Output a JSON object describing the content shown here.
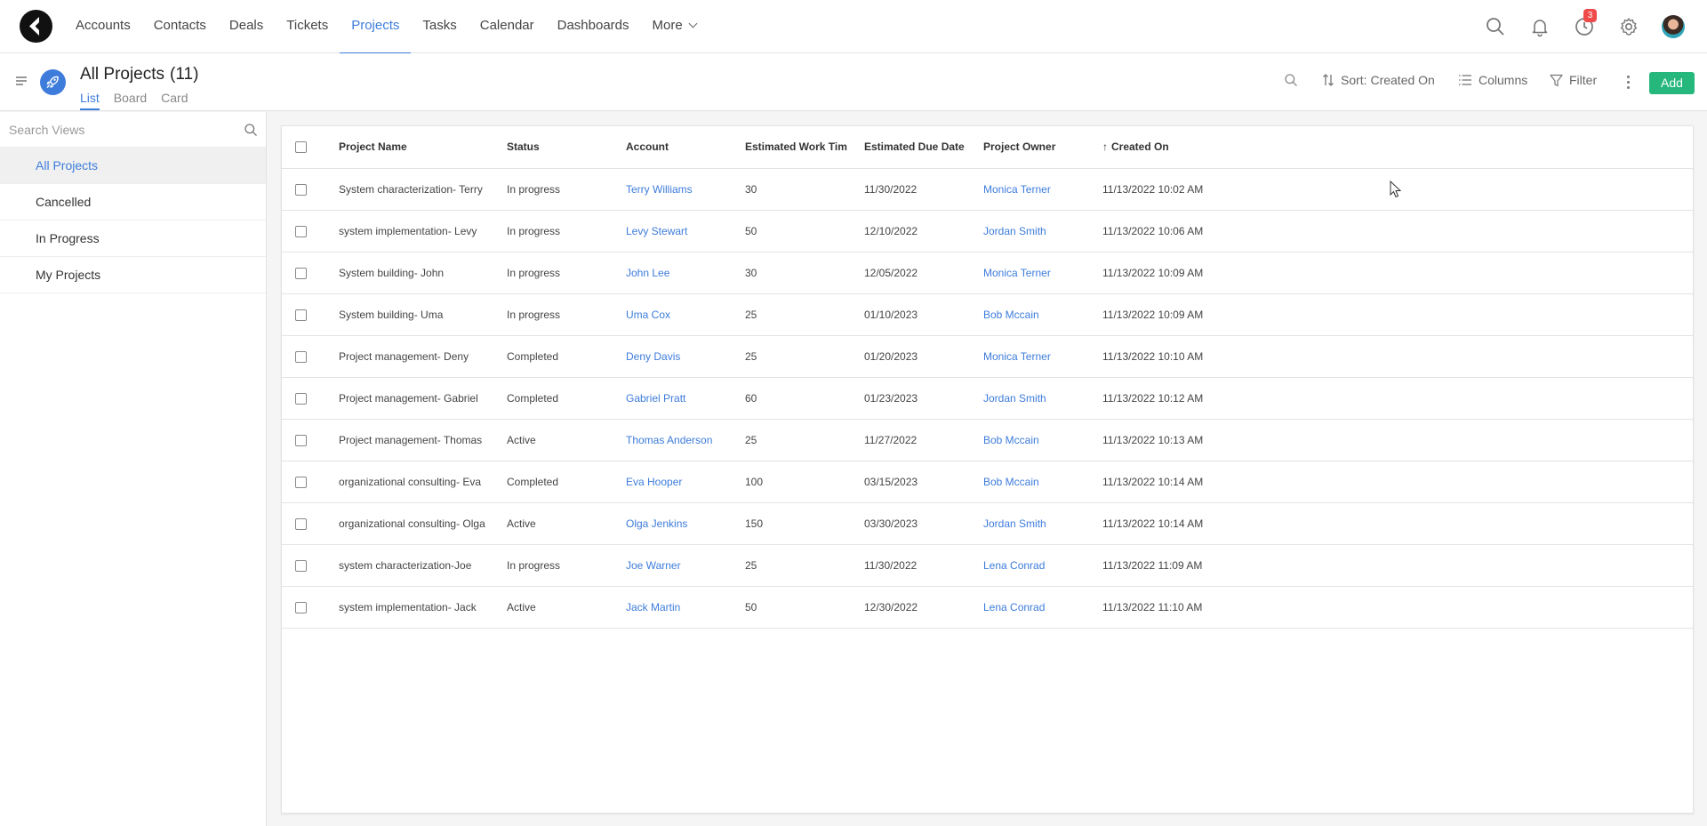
{
  "nav": {
    "items": [
      {
        "label": "Accounts",
        "active": false
      },
      {
        "label": "Contacts",
        "active": false
      },
      {
        "label": "Deals",
        "active": false
      },
      {
        "label": "Tickets",
        "active": false
      },
      {
        "label": "Projects",
        "active": true
      },
      {
        "label": "Tasks",
        "active": false
      },
      {
        "label": "Calendar",
        "active": false
      },
      {
        "label": "Dashboards",
        "active": false
      }
    ],
    "more_label": "More",
    "reminder_badge": "3",
    "accent": "#3d7cdb"
  },
  "header": {
    "title": "All Projects",
    "count": "(11)",
    "tabs": [
      {
        "label": "List",
        "active": true
      },
      {
        "label": "Board",
        "active": false
      },
      {
        "label": "Card",
        "active": false
      }
    ],
    "sort_label": "Sort: Created On",
    "columns_label": "Columns",
    "filter_label": "Filter",
    "add_label": "Add",
    "add_color": "#26b77d"
  },
  "sidebar": {
    "search_placeholder": "Search Views",
    "views": [
      {
        "label": "All Projects",
        "active": true
      },
      {
        "label": "Cancelled",
        "active": false
      },
      {
        "label": "In Progress",
        "active": false
      },
      {
        "label": "My Projects",
        "active": false
      }
    ]
  },
  "table": {
    "columns": [
      "Project Name",
      "Status",
      "Account",
      "Estimated Work Tim",
      "Estimated Due Date",
      "Project Owner",
      "Created On"
    ],
    "rows": [
      {
        "name": "System characterization- Terry",
        "status": "In progress",
        "account": "Terry Williams",
        "work": "30",
        "due": "11/30/2022",
        "owner": "Monica Terner",
        "created": "11/13/2022 10:02 AM"
      },
      {
        "name": "system implementation- Levy",
        "status": "In progress",
        "account": "Levy Stewart",
        "work": "50",
        "due": "12/10/2022",
        "owner": "Jordan Smith",
        "created": "11/13/2022 10:06 AM"
      },
      {
        "name": "System building- John",
        "status": "In progress",
        "account": "John Lee",
        "work": "30",
        "due": "12/05/2022",
        "owner": "Monica Terner",
        "created": "11/13/2022 10:09 AM"
      },
      {
        "name": "System building- Uma",
        "status": "In progress",
        "account": "Uma Cox",
        "work": "25",
        "due": "01/10/2023",
        "owner": "Bob Mccain",
        "created": "11/13/2022 10:09 AM"
      },
      {
        "name": "Project management- Deny",
        "status": "Completed",
        "account": "Deny Davis",
        "work": "25",
        "due": "01/20/2023",
        "owner": "Monica Terner",
        "created": "11/13/2022 10:10 AM"
      },
      {
        "name": "Project management- Gabriel",
        "status": "Completed",
        "account": "Gabriel Pratt",
        "work": "60",
        "due": "01/23/2023",
        "owner": "Jordan Smith",
        "created": "11/13/2022 10:12 AM"
      },
      {
        "name": "Project management- Thomas",
        "status": "Active",
        "account": "Thomas Anderson",
        "work": "25",
        "due": "11/27/2022",
        "owner": "Bob Mccain",
        "created": "11/13/2022 10:13 AM"
      },
      {
        "name": "organizational consulting- Eva",
        "status": "Completed",
        "account": "Eva Hooper",
        "work": "100",
        "due": "03/15/2023",
        "owner": "Bob Mccain",
        "created": "11/13/2022 10:14 AM"
      },
      {
        "name": "organizational consulting- Olga",
        "status": "Active",
        "account": "Olga Jenkins",
        "work": "150",
        "due": "03/30/2023",
        "owner": "Jordan Smith",
        "created": "11/13/2022 10:14 AM"
      },
      {
        "name": "system characterization-Joe",
        "status": "In progress",
        "account": "Joe Warner",
        "work": "25",
        "due": "11/30/2022",
        "owner": "Lena Conrad",
        "created": "11/13/2022 11:09 AM"
      },
      {
        "name": "system implementation- Jack",
        "status": "Active",
        "account": "Jack Martin",
        "work": "50",
        "due": "12/30/2022",
        "owner": "Lena Conrad",
        "created": "11/13/2022 11:10 AM"
      }
    ]
  }
}
